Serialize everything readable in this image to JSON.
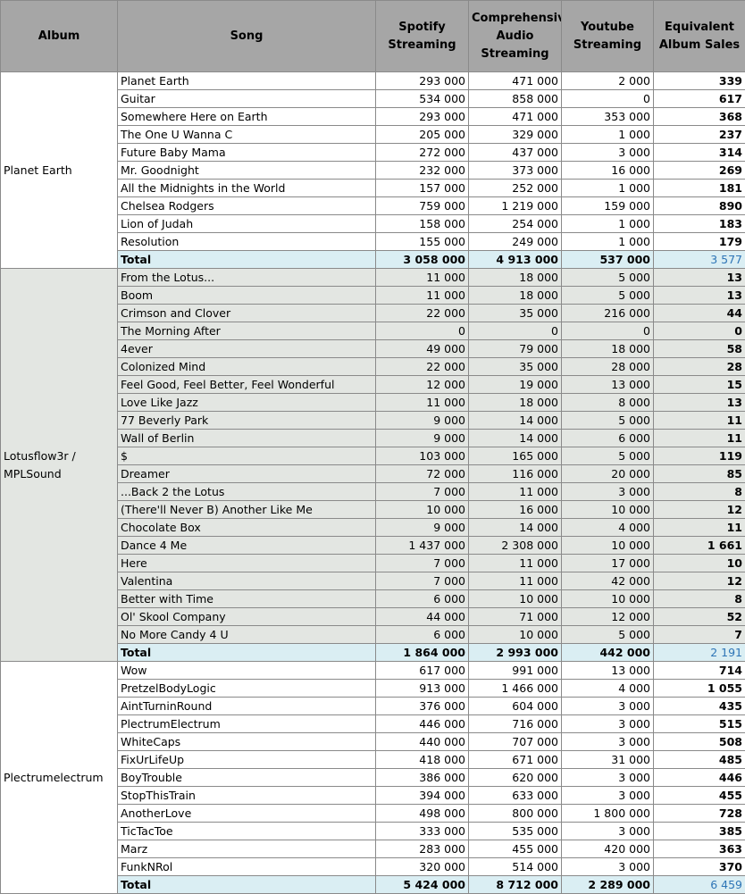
{
  "headers": {
    "album": "Album",
    "song": "Song",
    "spotify": "Spotify Streaming",
    "caudio": "Comprehensive Audio Streaming",
    "youtube": "Youtube Streaming",
    "eas": "Equivalent Album Sales"
  },
  "albums": [
    {
      "name": "Planet Earth",
      "songs": [
        {
          "song": "Planet Earth",
          "spotify": "293 000",
          "caudio": "471 000",
          "youtube": "2 000",
          "eas": "339"
        },
        {
          "song": "Guitar",
          "spotify": "534 000",
          "caudio": "858 000",
          "youtube": "0",
          "eas": "617"
        },
        {
          "song": "Somewhere Here on Earth",
          "spotify": "293 000",
          "caudio": "471 000",
          "youtube": "353 000",
          "eas": "368"
        },
        {
          "song": "The One U Wanna C",
          "spotify": "205 000",
          "caudio": "329 000",
          "youtube": "1 000",
          "eas": "237"
        },
        {
          "song": "Future Baby Mama",
          "spotify": "272 000",
          "caudio": "437 000",
          "youtube": "3 000",
          "eas": "314"
        },
        {
          "song": "Mr. Goodnight",
          "spotify": "232 000",
          "caudio": "373 000",
          "youtube": "16 000",
          "eas": "269"
        },
        {
          "song": "All the Midnights in the World",
          "spotify": "157 000",
          "caudio": "252 000",
          "youtube": "1 000",
          "eas": "181"
        },
        {
          "song": "Chelsea Rodgers",
          "spotify": "759 000",
          "caudio": "1 219 000",
          "youtube": "159 000",
          "eas": "890"
        },
        {
          "song": "Lion of Judah",
          "spotify": "158 000",
          "caudio": "254 000",
          "youtube": "1 000",
          "eas": "183"
        },
        {
          "song": "Resolution",
          "spotify": "155 000",
          "caudio": "249 000",
          "youtube": "1 000",
          "eas": "179"
        }
      ],
      "total": {
        "label": "Total",
        "spotify": "3 058 000",
        "caudio": "4 913 000",
        "youtube": "537 000",
        "eas": "3 577"
      }
    },
    {
      "name": "Lotusflow3r / MPLSound",
      "songs": [
        {
          "song": "From the Lotus...",
          "spotify": "11 000",
          "caudio": "18 000",
          "youtube": "5 000",
          "eas": "13"
        },
        {
          "song": "Boom",
          "spotify": "11 000",
          "caudio": "18 000",
          "youtube": "5 000",
          "eas": "13"
        },
        {
          "song": "Crimson and Clover",
          "spotify": "22 000",
          "caudio": "35 000",
          "youtube": "216 000",
          "eas": "44"
        },
        {
          "song": "The Morning After",
          "spotify": "0",
          "caudio": "0",
          "youtube": "0",
          "eas": "0"
        },
        {
          "song": "4ever",
          "spotify": "49 000",
          "caudio": "79 000",
          "youtube": "18 000",
          "eas": "58"
        },
        {
          "song": "Colonized Mind",
          "spotify": "22 000",
          "caudio": "35 000",
          "youtube": "28 000",
          "eas": "28"
        },
        {
          "song": "Feel Good, Feel Better, Feel Wonderful",
          "spotify": "12 000",
          "caudio": "19 000",
          "youtube": "13 000",
          "eas": "15"
        },
        {
          "song": "Love Like Jazz",
          "spotify": "11 000",
          "caudio": "18 000",
          "youtube": "8 000",
          "eas": "13"
        },
        {
          "song": "77 Beverly Park",
          "spotify": "9 000",
          "caudio": "14 000",
          "youtube": "5 000",
          "eas": "11"
        },
        {
          "song": "Wall of Berlin",
          "spotify": "9 000",
          "caudio": "14 000",
          "youtube": "6 000",
          "eas": "11"
        },
        {
          "song": "$",
          "spotify": "103 000",
          "caudio": "165 000",
          "youtube": "5 000",
          "eas": "119"
        },
        {
          "song": "Dreamer",
          "spotify": "72 000",
          "caudio": "116 000",
          "youtube": "20 000",
          "eas": "85"
        },
        {
          "song": "...Back 2 the Lotus",
          "spotify": "7 000",
          "caudio": "11 000",
          "youtube": "3 000",
          "eas": "8"
        },
        {
          "song": "(There'll Never B) Another Like Me",
          "spotify": "10 000",
          "caudio": "16 000",
          "youtube": "10 000",
          "eas": "12"
        },
        {
          "song": "Chocolate Box",
          "spotify": "9 000",
          "caudio": "14 000",
          "youtube": "4 000",
          "eas": "11"
        },
        {
          "song": "Dance 4 Me",
          "spotify": "1 437 000",
          "caudio": "2 308 000",
          "youtube": "10 000",
          "eas": "1 661"
        },
        {
          "song": "Here",
          "spotify": "7 000",
          "caudio": "11 000",
          "youtube": "17 000",
          "eas": "10"
        },
        {
          "song": "Valentina",
          "spotify": "7 000",
          "caudio": "11 000",
          "youtube": "42 000",
          "eas": "12"
        },
        {
          "song": "Better with Time",
          "spotify": "6 000",
          "caudio": "10 000",
          "youtube": "10 000",
          "eas": "8"
        },
        {
          "song": "Ol' Skool Company",
          "spotify": "44 000",
          "caudio": "71 000",
          "youtube": "12 000",
          "eas": "52"
        },
        {
          "song": "No More Candy 4 U",
          "spotify": "6 000",
          "caudio": "10 000",
          "youtube": "5 000",
          "eas": "7"
        }
      ],
      "total": {
        "label": "Total",
        "spotify": "1 864 000",
        "caudio": "2 993 000",
        "youtube": "442 000",
        "eas": "2 191"
      }
    },
    {
      "name": "Plectrumelectrum",
      "songs": [
        {
          "song": "Wow",
          "spotify": "617 000",
          "caudio": "991 000",
          "youtube": "13 000",
          "eas": "714"
        },
        {
          "song": "PretzelBodyLogic",
          "spotify": "913 000",
          "caudio": "1 466 000",
          "youtube": "4 000",
          "eas": "1 055"
        },
        {
          "song": "AintTurninRound",
          "spotify": "376 000",
          "caudio": "604 000",
          "youtube": "3 000",
          "eas": "435"
        },
        {
          "song": "PlectrumElectrum",
          "spotify": "446 000",
          "caudio": "716 000",
          "youtube": "3 000",
          "eas": "515"
        },
        {
          "song": "WhiteCaps",
          "spotify": "440 000",
          "caudio": "707 000",
          "youtube": "3 000",
          "eas": "508"
        },
        {
          "song": "FixUrLifeUp",
          "spotify": "418 000",
          "caudio": "671 000",
          "youtube": "31 000",
          "eas": "485"
        },
        {
          "song": "BoyTrouble",
          "spotify": "386 000",
          "caudio": "620 000",
          "youtube": "3 000",
          "eas": "446"
        },
        {
          "song": "StopThisTrain",
          "spotify": "394 000",
          "caudio": "633 000",
          "youtube": "3 000",
          "eas": "455"
        },
        {
          "song": "AnotherLove",
          "spotify": "498 000",
          "caudio": "800 000",
          "youtube": "1 800 000",
          "eas": "728"
        },
        {
          "song": "TicTacToe",
          "spotify": "333 000",
          "caudio": "535 000",
          "youtube": "3 000",
          "eas": "385"
        },
        {
          "song": "Marz",
          "spotify": "283 000",
          "caudio": "455 000",
          "youtube": "420 000",
          "eas": "363"
        },
        {
          "song": "FunkNRol",
          "spotify": "320 000",
          "caudio": "514 000",
          "youtube": "3 000",
          "eas": "370"
        }
      ],
      "total": {
        "label": "Total",
        "spotify": "5 424 000",
        "caudio": "8 712 000",
        "youtube": "2 289 000",
        "eas": "6 459"
      }
    }
  ]
}
